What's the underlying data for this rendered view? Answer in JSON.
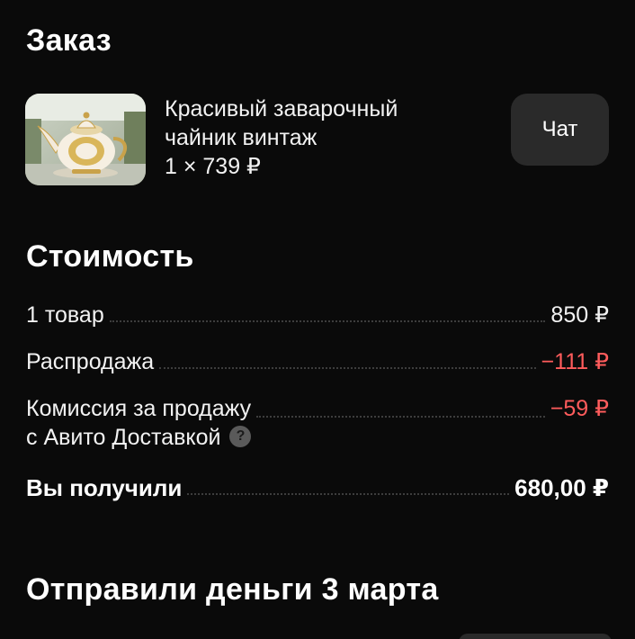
{
  "order": {
    "title": "Заказ",
    "item": {
      "name": "Красивый заварочный чайник винтаж",
      "quantity_price": "1 × 739 ₽",
      "image_icon": "teapot-photo"
    },
    "chat_label": "Чат"
  },
  "cost": {
    "title": "Стоимость",
    "items_label": "1 товар",
    "items_value": "850 ₽",
    "sale_label": "Распродажа",
    "sale_value": "−111 ₽",
    "commission_label_line1": "Комиссия за продажу",
    "commission_label_line2": "с Авито Доставкой",
    "commission_value": "−59 ₽",
    "help_icon": "question-circle-icon",
    "total_label": "Вы получили",
    "total_value": "680,00 ₽"
  },
  "payout": {
    "title": "Отправили деньги 3 марта"
  },
  "colors": {
    "background": "#0a0a0a",
    "button_bg": "#2a2a2a",
    "negative": "#ff5c5c"
  }
}
